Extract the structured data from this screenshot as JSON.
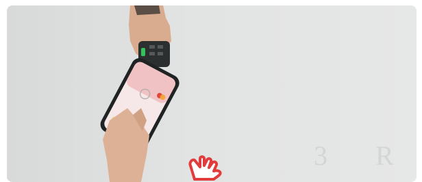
{
  "colors": {
    "background": "#e2e3e3",
    "hand_cursor_outline": "#e23b3b",
    "card_light": "#f1b6b0"
  },
  "watermark_text": "3 R",
  "icons": {
    "hand_cursor": "hand-pointer-icon"
  }
}
